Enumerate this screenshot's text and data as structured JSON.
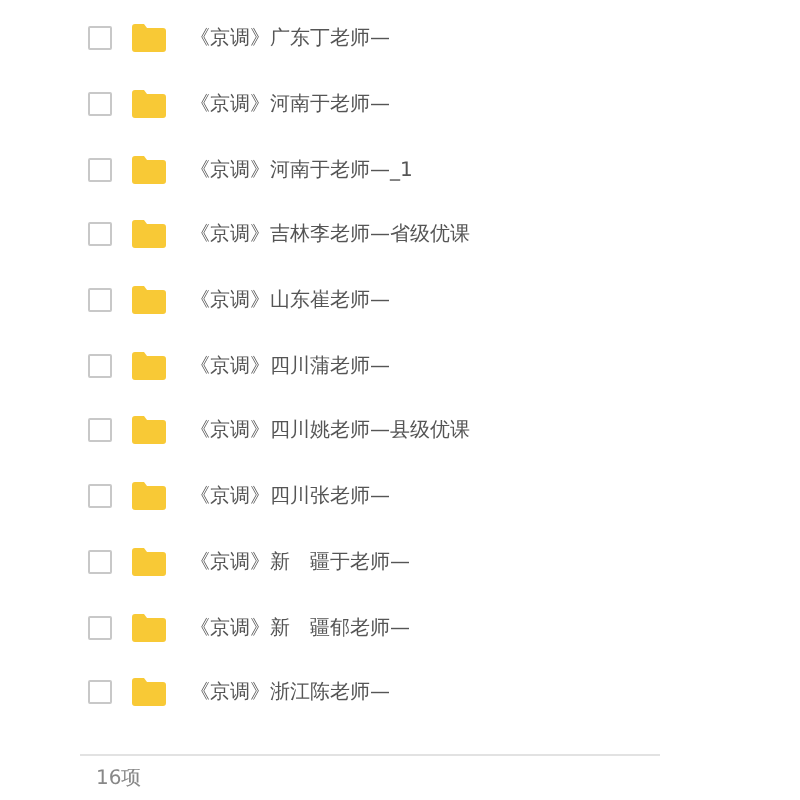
{
  "files": [
    {
      "name": "《京调》广东丁老师—",
      "checked": false
    },
    {
      "name": "《京调》河南于老师—",
      "checked": false
    },
    {
      "name": "《京调》河南于老师—_1",
      "checked": false
    },
    {
      "name": "《京调》吉林李老师—省级优课",
      "checked": false
    },
    {
      "name": "《京调》山东崔老师—",
      "checked": false
    },
    {
      "name": "《京调》四川蒲老师—",
      "checked": false
    },
    {
      "name": "《京调》四川姚老师—县级优课",
      "checked": false
    },
    {
      "name": "《京调》四川张老师—",
      "checked": false
    },
    {
      "name": "《京调》新　疆于老师—",
      "checked": false
    },
    {
      "name": "《京调》新　疆郁老师—",
      "checked": false
    },
    {
      "name": "《京调》浙江陈老师—",
      "checked": false
    }
  ],
  "status_bar": {
    "count": "16项"
  }
}
